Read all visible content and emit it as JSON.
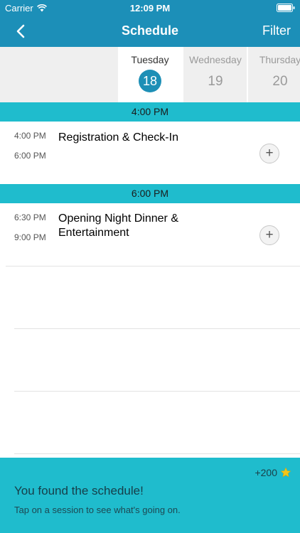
{
  "status_bar": {
    "carrier": "Carrier",
    "time": "12:09 PM"
  },
  "nav": {
    "title": "Schedule",
    "filter_label": "Filter",
    "back_icon": "chevron-left-icon"
  },
  "days": [
    {
      "name": "Tuesday",
      "number": "18",
      "selected": true
    },
    {
      "name": "Wednesday",
      "number": "19",
      "selected": false
    },
    {
      "name": "Thursday",
      "number": "20",
      "selected": false
    }
  ],
  "sections": [
    {
      "header": "4:00 PM",
      "sessions": [
        {
          "start": "4:00 PM",
          "end": "6:00 PM",
          "title": "Registration & Check-In"
        }
      ]
    },
    {
      "header": "6:00 PM",
      "sessions": [
        {
          "start": "6:30 PM",
          "end": "9:00 PM",
          "title": "Opening Night Dinner & Entertainment"
        }
      ]
    }
  ],
  "toast": {
    "points": "+200",
    "points_icon": "star-icon",
    "headline": "You found the schedule!",
    "subtext": "Tap on a session to see what's going on."
  },
  "colors": {
    "nav_background": "#1c8fb8",
    "section_header": "#1fbccd",
    "selected_day_circle": "#1d8fb6",
    "toast_background": "#1fbccd",
    "star": "#f5c518"
  }
}
